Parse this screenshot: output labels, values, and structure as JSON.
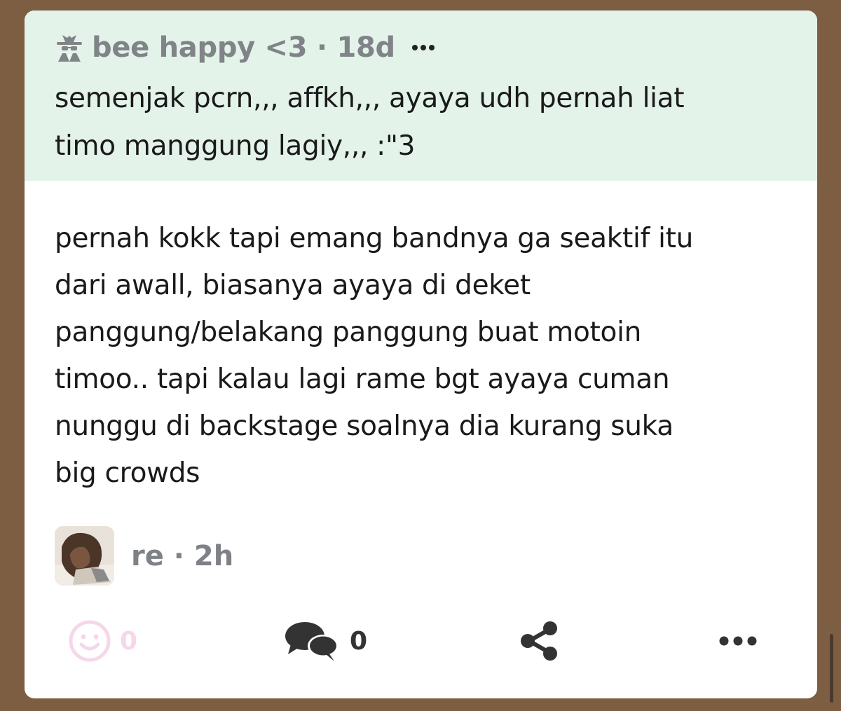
{
  "quote": {
    "author": "bee happy <3",
    "age": "18d",
    "meta": "bee happy <3 · 18d",
    "author_icon": "spy-icon",
    "text": "semenjak pcrn,,, affkh,,, ayaya udh pernah liat\ntimo manggung lagiy,,, :\"3"
  },
  "reply": {
    "text": "pernah kokk tapi emang bandnya ga seaktif itu\ndari awall, biasanya ayaya di deket\npanggung/belakang panggung buat motoin\ntimoo.. tapi kalau lagi rame bgt ayaya cuman\nnunggu di backstage soalnya dia kurang suka\nbig crowds",
    "author": "re",
    "age": "2h",
    "meta": "re · 2h"
  },
  "actions": {
    "reactions_count": "0",
    "comments_count": "0"
  },
  "colors": {
    "background": "#7d5e42",
    "quote_bg": "#e3f3ea",
    "reaction_pink": "#f6d7e9",
    "icon_dark": "#333333",
    "meta_gray": "#808387"
  }
}
